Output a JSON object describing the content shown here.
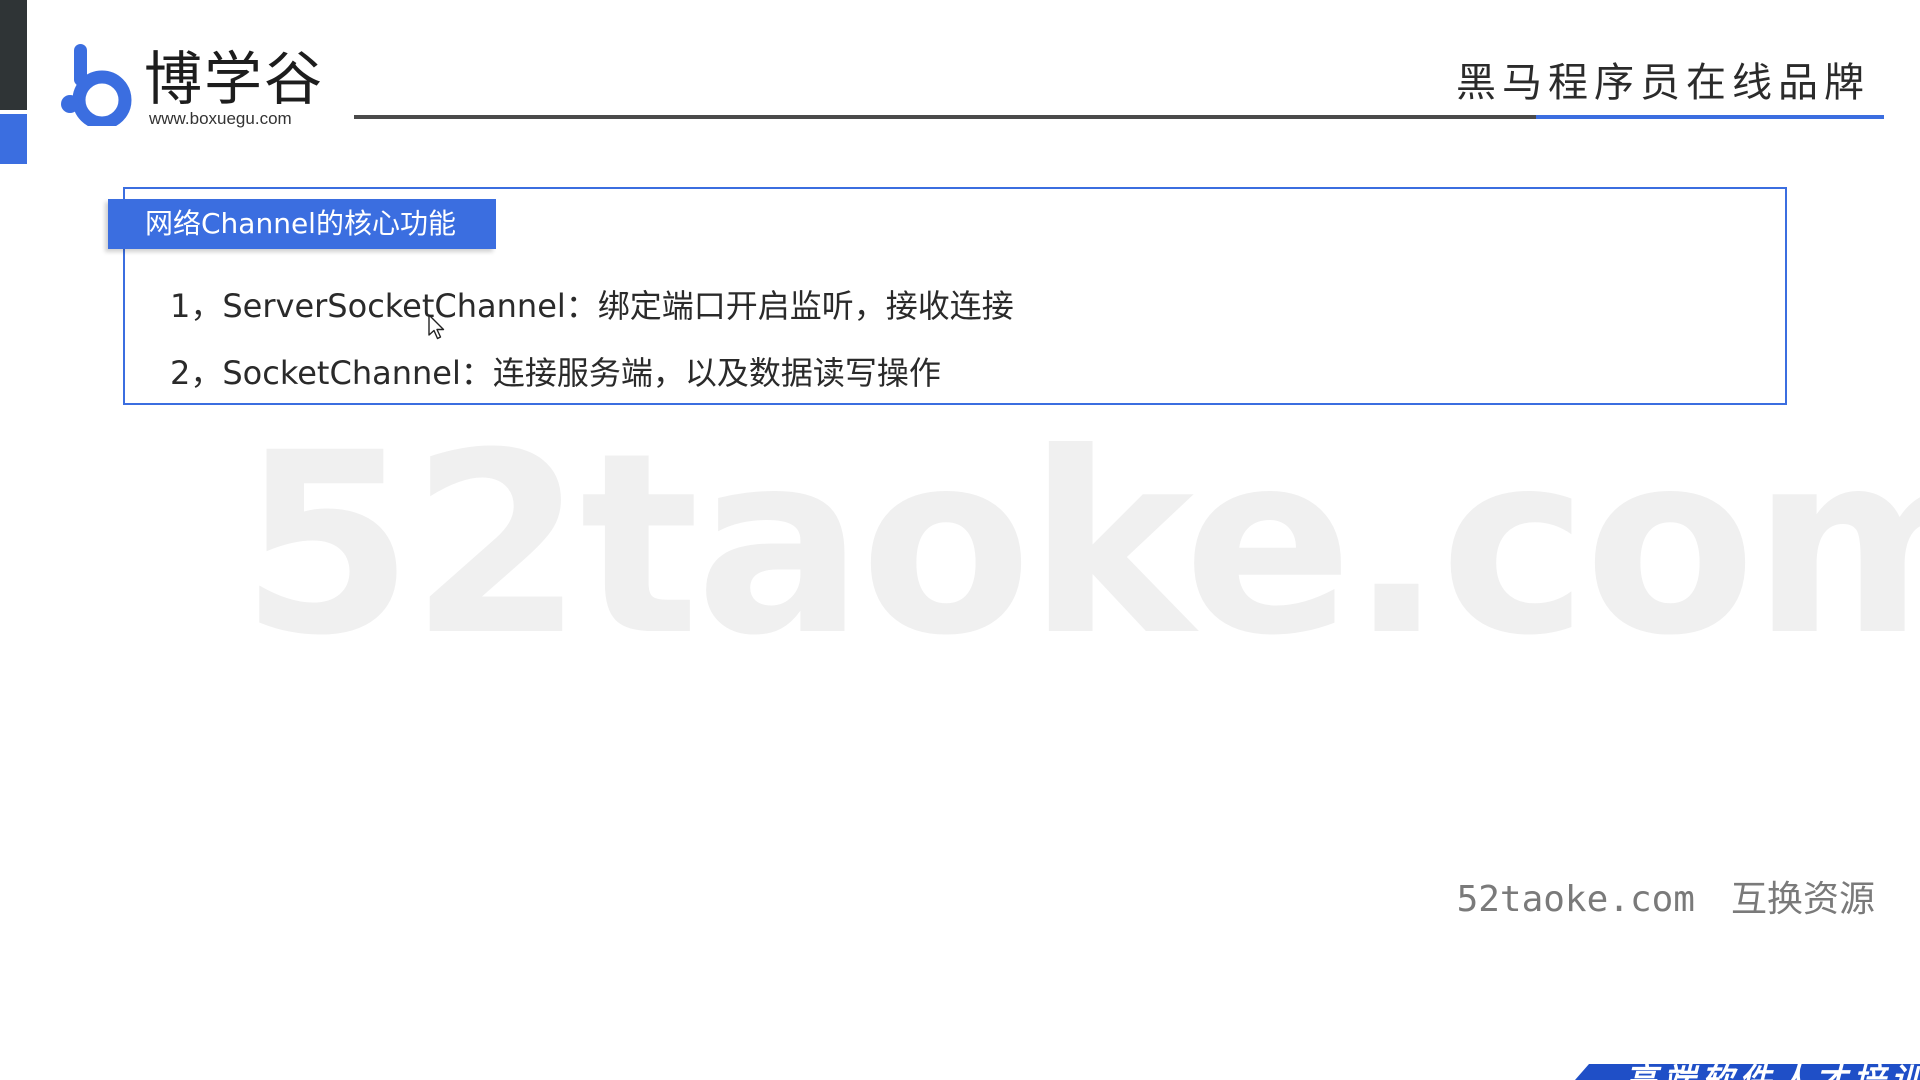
{
  "header": {
    "logo_text": "博学谷",
    "logo_url": "www.boxuegu.com",
    "brand_slogan": "黑马程序员在线品牌",
    "accent_color": "#3b6ee0"
  },
  "content": {
    "title": "网络Channel的核心功能",
    "items": [
      "1，ServerSocketChannel：绑定端口开启监听，接收连接",
      "2，SocketChannel：连接服务端，以及数据读写操作"
    ]
  },
  "watermark": {
    "big_text": "52taoke.com",
    "footer_site": "52taoke.com",
    "footer_label": "互换资源"
  },
  "ribbon": {
    "text": "高端软件人才培训专家"
  }
}
